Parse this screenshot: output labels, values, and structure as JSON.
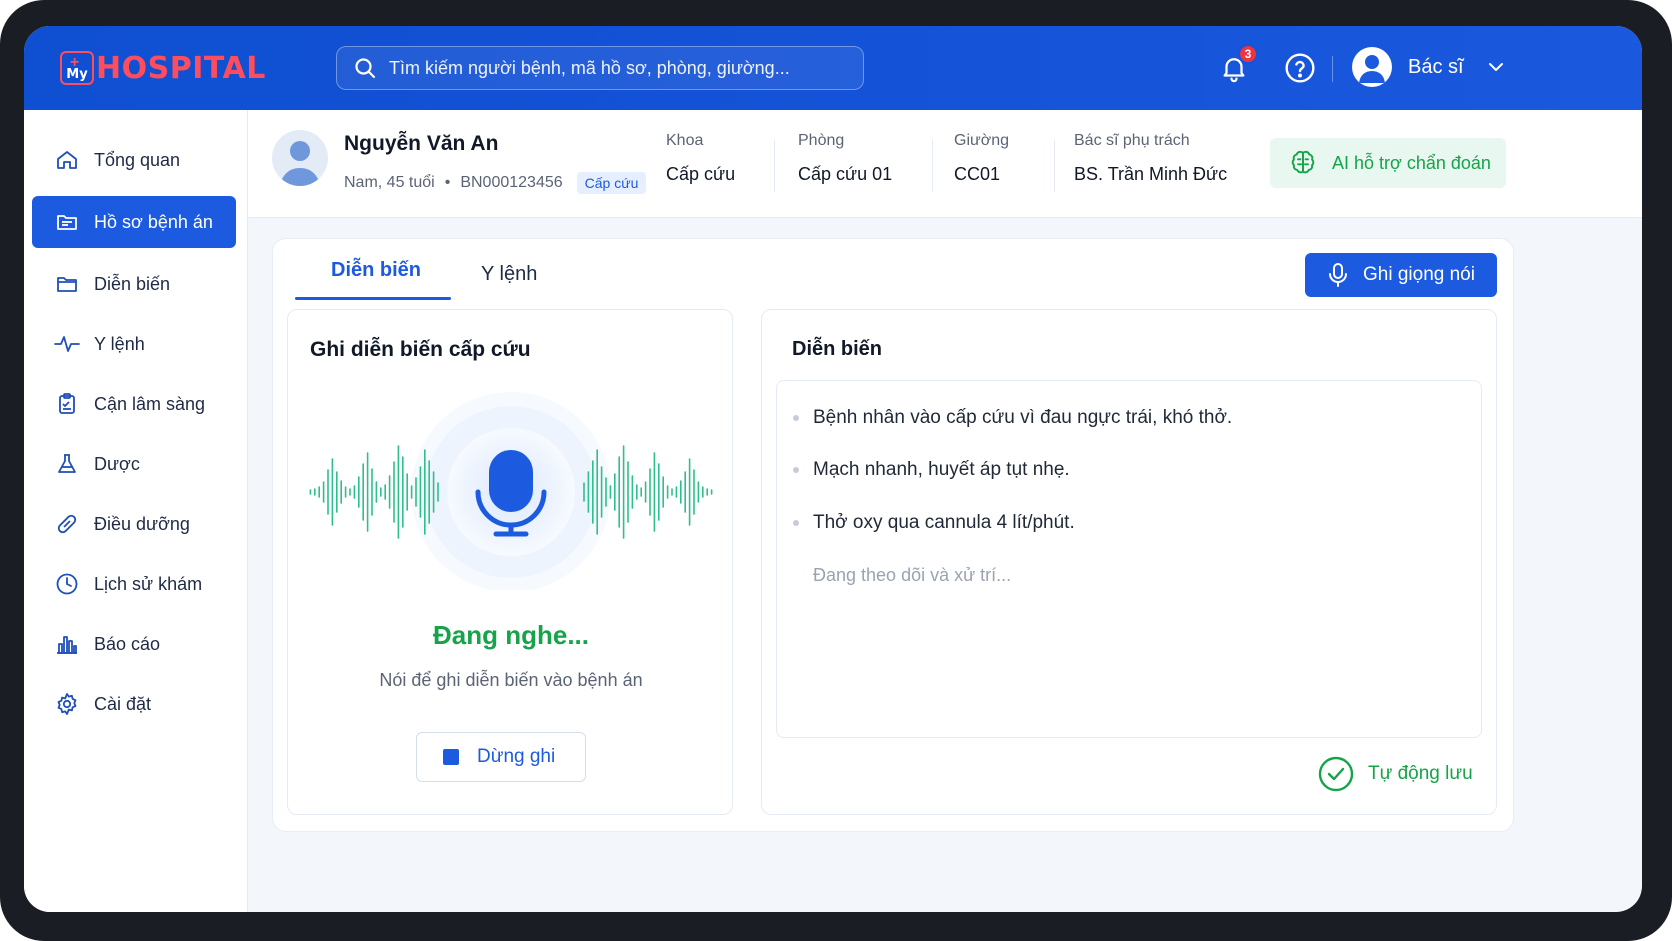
{
  "app": {
    "logo_small": "My",
    "logo_text": "HOSPITAL"
  },
  "header": {
    "search_placeholder": "Tìm kiếm người bệnh, mã hồ sơ, phòng, giường...",
    "notification_count": "3",
    "user_label": "Bác sĩ"
  },
  "sidebar": {
    "items": [
      {
        "label": "Tổng quan",
        "icon": "home-icon"
      },
      {
        "label": "Hồ sơ bệnh án",
        "icon": "folder-icon",
        "active": true
      },
      {
        "label": "Diễn biến",
        "icon": "folder-outline-icon"
      },
      {
        "label": "Y lệnh",
        "icon": "pulse-icon"
      },
      {
        "label": "Cận lâm sàng",
        "icon": "clipboard-icon"
      },
      {
        "label": "Dược",
        "icon": "flask-icon"
      },
      {
        "label": "Điều dưỡng",
        "icon": "bandage-icon"
      },
      {
        "label": "Lịch sử khám",
        "icon": "clock-icon"
      },
      {
        "label": "Báo cáo",
        "icon": "bar-chart-icon"
      },
      {
        "label": "Cài đặt",
        "icon": "gear-icon"
      }
    ]
  },
  "patient": {
    "name": "Nguyễn Văn An",
    "demographics": "Nam, 45 tuổi",
    "record_id": "BN000123456",
    "tag": "Cấp cứu",
    "fields": [
      {
        "label": "Khoa",
        "value": "Cấp cứu"
      },
      {
        "label": "Phòng",
        "value": "Cấp cứu 01"
      },
      {
        "label": "Giường",
        "value": "CC01"
      },
      {
        "label": "Bác sĩ phụ trách",
        "value": "BS. Trần Minh Đức"
      }
    ],
    "ai_button": "AI hỗ trợ chẩn đoán"
  },
  "main": {
    "tabs": [
      {
        "label": "Diễn biến",
        "active": true
      },
      {
        "label": "Y lệnh",
        "active": false
      }
    ],
    "voice_button": "Ghi giọng nói",
    "recorder": {
      "title": "Ghi diễn biến cấp cứu",
      "status": "Đang nghe...",
      "hint": "Nói để ghi diễn biến vào bệnh án",
      "stop_button": "Dừng ghi"
    },
    "notes": {
      "title": "Diễn biến",
      "items": [
        "Bệnh nhân vào cấp cứu vì đau ngực trái, khó thở.",
        "Mạch nhanh, huyết áp tụt nhẹ.",
        "Thở oxy qua cannula 4 lít/phút."
      ],
      "placeholder": "Đang theo dõi và xử trí...",
      "autosave": "Tự động lưu"
    }
  },
  "colors": {
    "primary": "#1c5be0",
    "header": "#1553d8",
    "success": "#16a34a",
    "logo": "#ff4d5e"
  }
}
